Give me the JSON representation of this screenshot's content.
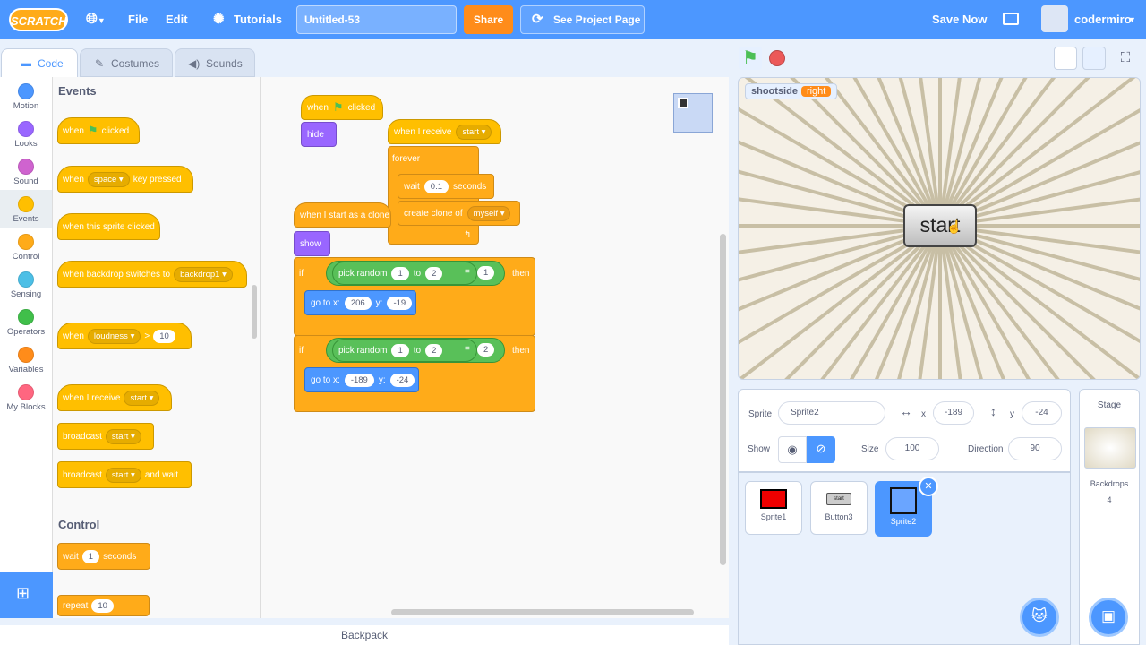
{
  "menubar": {
    "logo": "SCRATCH",
    "file": "File",
    "edit": "Edit",
    "tutorials": "Tutorials",
    "project_title": "Untitled-53",
    "share": "Share",
    "see_project": "See Project Page",
    "save_now": "Save Now",
    "username": "codermiro"
  },
  "tabs": {
    "code": "Code",
    "costumes": "Costumes",
    "sounds": "Sounds"
  },
  "categories": [
    {
      "label": "Motion",
      "color": "#4c97ff"
    },
    {
      "label": "Looks",
      "color": "#9966ff"
    },
    {
      "label": "Sound",
      "color": "#cf63cf"
    },
    {
      "label": "Events",
      "color": "#ffbf00"
    },
    {
      "label": "Control",
      "color": "#ffab19"
    },
    {
      "label": "Sensing",
      "color": "#4cbfe6"
    },
    {
      "label": "Operators",
      "color": "#40bf4a"
    },
    {
      "label": "Variables",
      "color": "#ff8c1a"
    },
    {
      "label": "My Blocks",
      "color": "#ff6680"
    }
  ],
  "palette": {
    "events_heading": "Events",
    "control_heading": "Control",
    "b1": {
      "when": "when",
      "clicked": "clicked"
    },
    "b2": {
      "when": "when",
      "key": "space",
      "pressed": "key pressed"
    },
    "b3": "when this sprite clicked",
    "b4": {
      "text": "when backdrop switches to",
      "backdrop": "backdrop1"
    },
    "b5": {
      "when": "when",
      "sensor": "loudness",
      "op": ">",
      "value": "10"
    },
    "b6": {
      "text": "when I receive",
      "msg": "start"
    },
    "b7": {
      "text": "broadcast",
      "msg": "start"
    },
    "b8": {
      "text": "broadcast",
      "msg": "start",
      "wait": "and wait"
    },
    "b9": {
      "wait": "wait",
      "value": "1",
      "seconds": "seconds"
    },
    "b10": {
      "repeat": "repeat",
      "value": "10"
    }
  },
  "code": {
    "s1": {
      "when": "when",
      "clicked": "clicked",
      "hide": "hide"
    },
    "s2": {
      "receive": "when I receive",
      "msg": "start",
      "forever": "forever",
      "wait": "wait",
      "wait_val": "0.1",
      "seconds": "seconds",
      "create": "create clone of",
      "target": "myself"
    },
    "s3": {
      "hat": "when I start as a clone",
      "show": "show",
      "if1": {
        "if": "if",
        "pick": "pick random",
        "from": "1",
        "to": "to",
        "to_val": "2",
        "eq": "=",
        "cmp": "1",
        "then": "then",
        "goto": "go to x:",
        "x": "206",
        "ylbl": "y:",
        "y": "-19"
      },
      "if2": {
        "if": "if",
        "pick": "pick random",
        "from": "1",
        "to": "to",
        "to_val": "2",
        "eq": "=",
        "cmp": "2",
        "then": "then",
        "goto": "go to x:",
        "x": "-189",
        "ylbl": "y:",
        "y": "-24"
      }
    },
    "zoom_in": "+",
    "zoom_out": "−",
    "zoom_reset": "="
  },
  "backpack": "Backpack",
  "stage": {
    "var_name": "shootside",
    "var_value": "right",
    "button_text": "start"
  },
  "sprite_info": {
    "sprite_label": "Sprite",
    "sprite_name": "Sprite2",
    "x_label": "x",
    "x": "-189",
    "y_label": "y",
    "y": "-24",
    "show_label": "Show",
    "size_label": "Size",
    "size": "100",
    "direction_label": "Direction",
    "direction": "90"
  },
  "sprites": [
    "Sprite1",
    "Button3",
    "Sprite2"
  ],
  "stage_panel": {
    "title": "Stage",
    "backdrops_label": "Backdrops",
    "backdrops_count": "4"
  }
}
